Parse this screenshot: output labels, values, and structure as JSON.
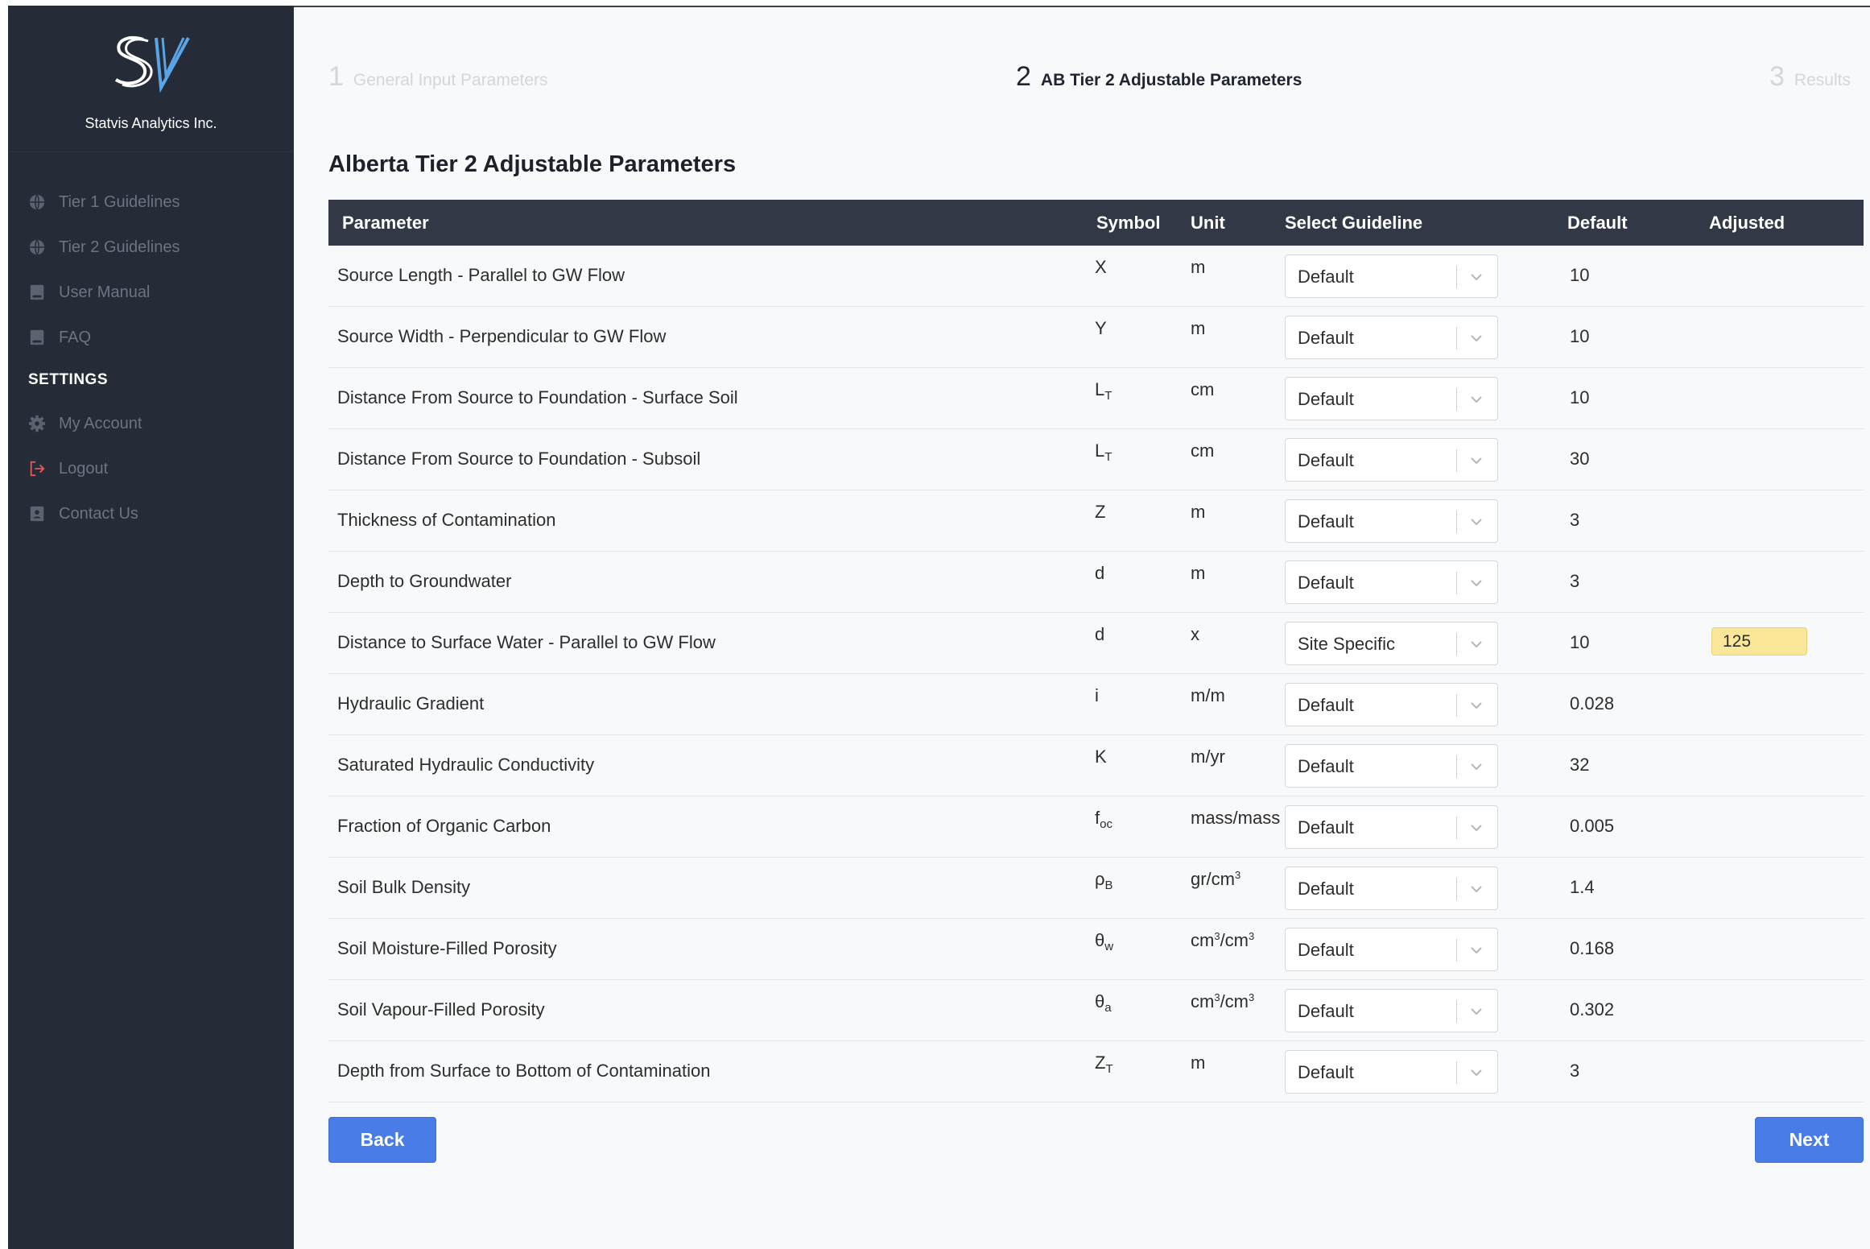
{
  "sidebar": {
    "company": "Statvis Analytics Inc.",
    "items": [
      {
        "label": "Tier 1 Guidelines",
        "icon": "globe-icon"
      },
      {
        "label": "Tier 2 Guidelines",
        "icon": "globe-icon"
      },
      {
        "label": "User Manual",
        "icon": "book-icon"
      },
      {
        "label": "FAQ",
        "icon": "book-icon"
      }
    ],
    "settings_heading": "SETTINGS",
    "settings_items": [
      {
        "label": "My Account",
        "icon": "gear-icon"
      },
      {
        "label": "Logout",
        "icon": "logout-icon",
        "color": "#e25b5b"
      },
      {
        "label": "Contact Us",
        "icon": "contact-icon"
      }
    ]
  },
  "stepper": [
    {
      "num": "1",
      "label": "General Input Parameters",
      "state": "inactive"
    },
    {
      "num": "2",
      "label": "AB Tier 2 Adjustable Parameters",
      "state": "active"
    },
    {
      "num": "3",
      "label": "Results",
      "state": "inactive"
    }
  ],
  "page_title": "Alberta Tier 2 Adjustable Parameters",
  "table": {
    "headers": {
      "parameter": "Parameter",
      "symbol": "Symbol",
      "unit": "Unit",
      "guideline": "Select Guideline",
      "default": "Default",
      "adjusted": "Adjusted"
    },
    "rows": [
      {
        "param": "Source Length - Parallel to GW Flow",
        "sym": "X",
        "sym_sub": "",
        "unit": "m",
        "unit_sup": "",
        "unit2": "",
        "unit2_sup": "",
        "guideline": "Default",
        "default": "10",
        "adjusted": ""
      },
      {
        "param": "Source Width - Perpendicular to GW Flow",
        "sym": "Y",
        "sym_sub": "",
        "unit": "m",
        "unit_sup": "",
        "unit2": "",
        "unit2_sup": "",
        "guideline": "Default",
        "default": "10",
        "adjusted": ""
      },
      {
        "param": "Distance From Source to Foundation - Surface Soil",
        "sym": "L",
        "sym_sub": "T",
        "unit": "cm",
        "unit_sup": "",
        "unit2": "",
        "unit2_sup": "",
        "guideline": "Default",
        "default": "10",
        "adjusted": ""
      },
      {
        "param": "Distance From Source to Foundation - Subsoil",
        "sym": "L",
        "sym_sub": "T",
        "unit": "cm",
        "unit_sup": "",
        "unit2": "",
        "unit2_sup": "",
        "guideline": "Default",
        "default": "30",
        "adjusted": ""
      },
      {
        "param": "Thickness of Contamination",
        "sym": "Z",
        "sym_sub": "",
        "unit": "m",
        "unit_sup": "",
        "unit2": "",
        "unit2_sup": "",
        "guideline": "Default",
        "default": "3",
        "adjusted": ""
      },
      {
        "param": "Depth to Groundwater",
        "sym": "d",
        "sym_sub": "",
        "unit": "m",
        "unit_sup": "",
        "unit2": "",
        "unit2_sup": "",
        "guideline": "Default",
        "default": "3",
        "adjusted": ""
      },
      {
        "param": "Distance to Surface Water - Parallel to GW Flow",
        "sym": "d",
        "sym_sub": "",
        "unit": "x",
        "unit_sup": "",
        "unit2": "",
        "unit2_sup": "",
        "guideline": "Site Specific",
        "default": "10",
        "adjusted": "125"
      },
      {
        "param": "Hydraulic Gradient",
        "sym": "i",
        "sym_sub": "",
        "unit": "m/m",
        "unit_sup": "",
        "unit2": "",
        "unit2_sup": "",
        "guideline": "Default",
        "default": "0.028",
        "adjusted": ""
      },
      {
        "param": "Saturated Hydraulic Conductivity",
        "sym": "K",
        "sym_sub": "",
        "unit": "m/yr",
        "unit_sup": "",
        "unit2": "",
        "unit2_sup": "",
        "guideline": "Default",
        "default": "32",
        "adjusted": ""
      },
      {
        "param": "Fraction of Organic Carbon",
        "sym": "f",
        "sym_sub": "oc",
        "unit": "mass/mass",
        "unit_sup": "",
        "unit2": "",
        "unit2_sup": "",
        "guideline": "Default",
        "default": "0.005",
        "adjusted": ""
      },
      {
        "param": "Soil Bulk Density",
        "sym": "ρ",
        "sym_sub": "B",
        "unit": "gr/cm",
        "unit_sup": "3",
        "unit2": "",
        "unit2_sup": "",
        "guideline": "Default",
        "default": "1.4",
        "adjusted": ""
      },
      {
        "param": "Soil Moisture-Filled Porosity",
        "sym": "θ",
        "sym_sub": "w",
        "unit": "cm",
        "unit_sup": "3",
        "unit2": "/cm",
        "unit2_sup": "3",
        "guideline": "Default",
        "default": "0.168",
        "adjusted": ""
      },
      {
        "param": "Soil Vapour-Filled Porosity",
        "sym": "θ",
        "sym_sub": "a",
        "unit": "cm",
        "unit_sup": "3",
        "unit2": "/cm",
        "unit2_sup": "3",
        "guideline": "Default",
        "default": "0.302",
        "adjusted": ""
      },
      {
        "param": "Depth from Surface to Bottom of Contamination",
        "sym": "Z",
        "sym_sub": "T",
        "unit": "m",
        "unit_sup": "",
        "unit2": "",
        "unit2_sup": "",
        "guideline": "Default",
        "default": "3",
        "adjusted": ""
      }
    ]
  },
  "buttons": {
    "back": "Back",
    "next": "Next"
  },
  "colors": {
    "sidebar_bg": "#262b38",
    "header_bg": "#333847",
    "primary": "#4a7ce8",
    "adjusted_bg": "#fbe79a"
  }
}
